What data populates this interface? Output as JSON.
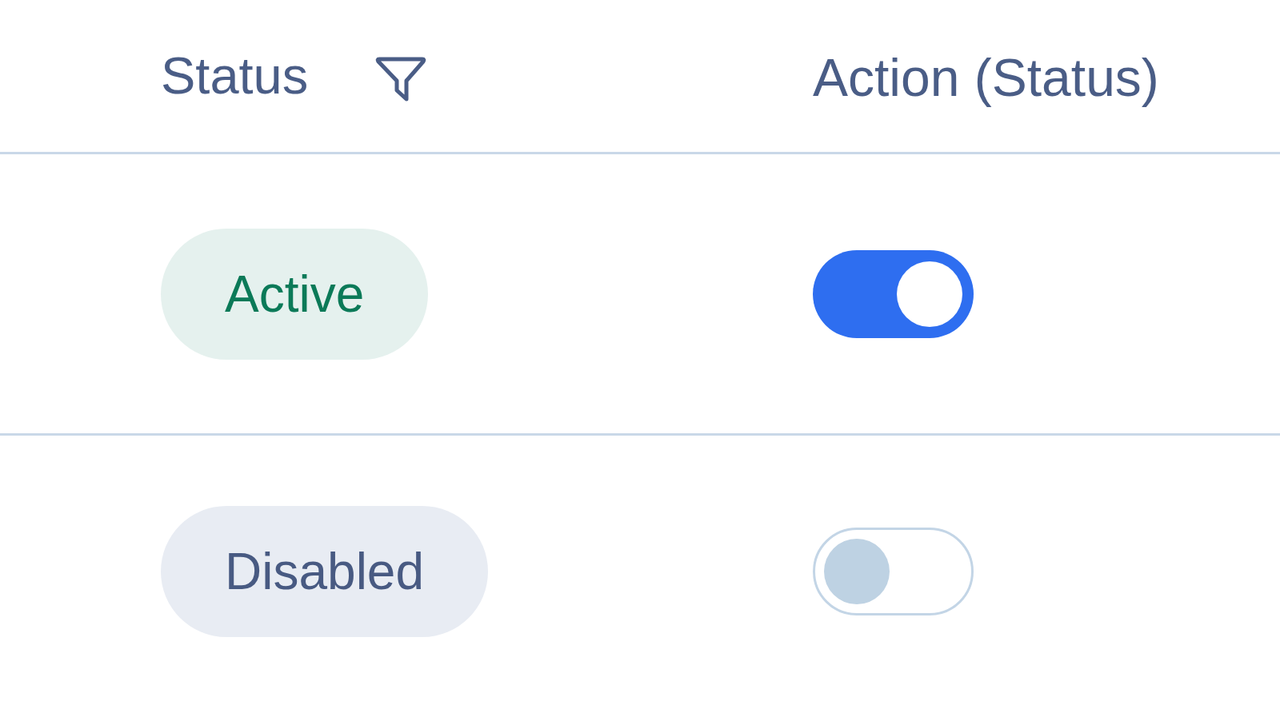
{
  "table": {
    "columns": [
      {
        "label": "Status",
        "filter": true
      },
      {
        "label": "Action (Status)"
      }
    ],
    "rows": [
      {
        "status": {
          "label": "Active",
          "kind": "active"
        },
        "toggle": {
          "on": true
        }
      },
      {
        "status": {
          "label": "Disabled",
          "kind": "disabled"
        },
        "toggle": {
          "on": false
        }
      }
    ]
  }
}
